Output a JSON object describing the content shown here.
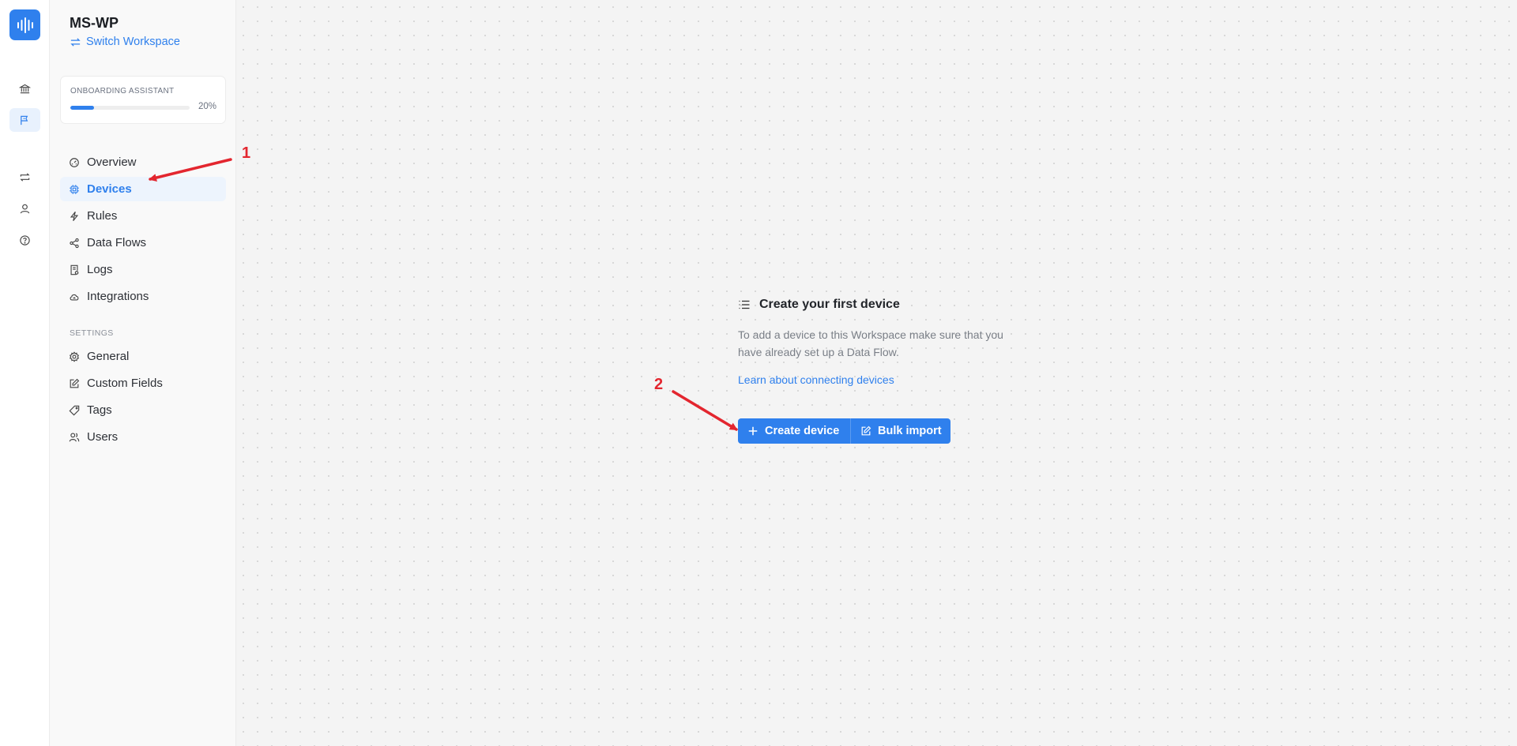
{
  "workspace": {
    "name": "MS-WP",
    "switch_label": "Switch Workspace"
  },
  "rail": {
    "items": [
      {
        "icon": "bank-icon"
      },
      {
        "icon": "flag-icon",
        "active": true
      },
      {
        "icon": "repeat-icon"
      },
      {
        "icon": "user-icon"
      },
      {
        "icon": "help-icon"
      }
    ]
  },
  "onboarding": {
    "title": "ONBOARDING ASSISTANT",
    "progress_label": "20%",
    "progress": 0.2
  },
  "nav": {
    "items": [
      {
        "label": "Overview",
        "icon": "gauge-icon"
      },
      {
        "label": "Devices",
        "icon": "chip-icon",
        "active": true
      },
      {
        "label": "Rules",
        "icon": "bolt-icon"
      },
      {
        "label": "Data Flows",
        "icon": "share-icon"
      },
      {
        "label": "Logs",
        "icon": "log-icon"
      },
      {
        "label": "Integrations",
        "icon": "cloud-icon"
      }
    ],
    "settings_label": "SETTINGS",
    "settings_items": [
      {
        "label": "General",
        "icon": "gear-icon"
      },
      {
        "label": "Custom Fields",
        "icon": "edit-icon"
      },
      {
        "label": "Tags",
        "icon": "tag-icon"
      },
      {
        "label": "Users",
        "icon": "users-icon"
      }
    ]
  },
  "empty_state": {
    "title": "Create your first device",
    "description": "To add a device to this Workspace make sure that you have already set up a Data Flow.",
    "link": "Learn about connecting devices",
    "create_button": "Create device",
    "bulk_button": "Bulk import"
  },
  "annotations": {
    "marker_1": "1",
    "marker_2": "2",
    "color": "#e3262f"
  },
  "colors": {
    "accent": "#2f80ed"
  }
}
